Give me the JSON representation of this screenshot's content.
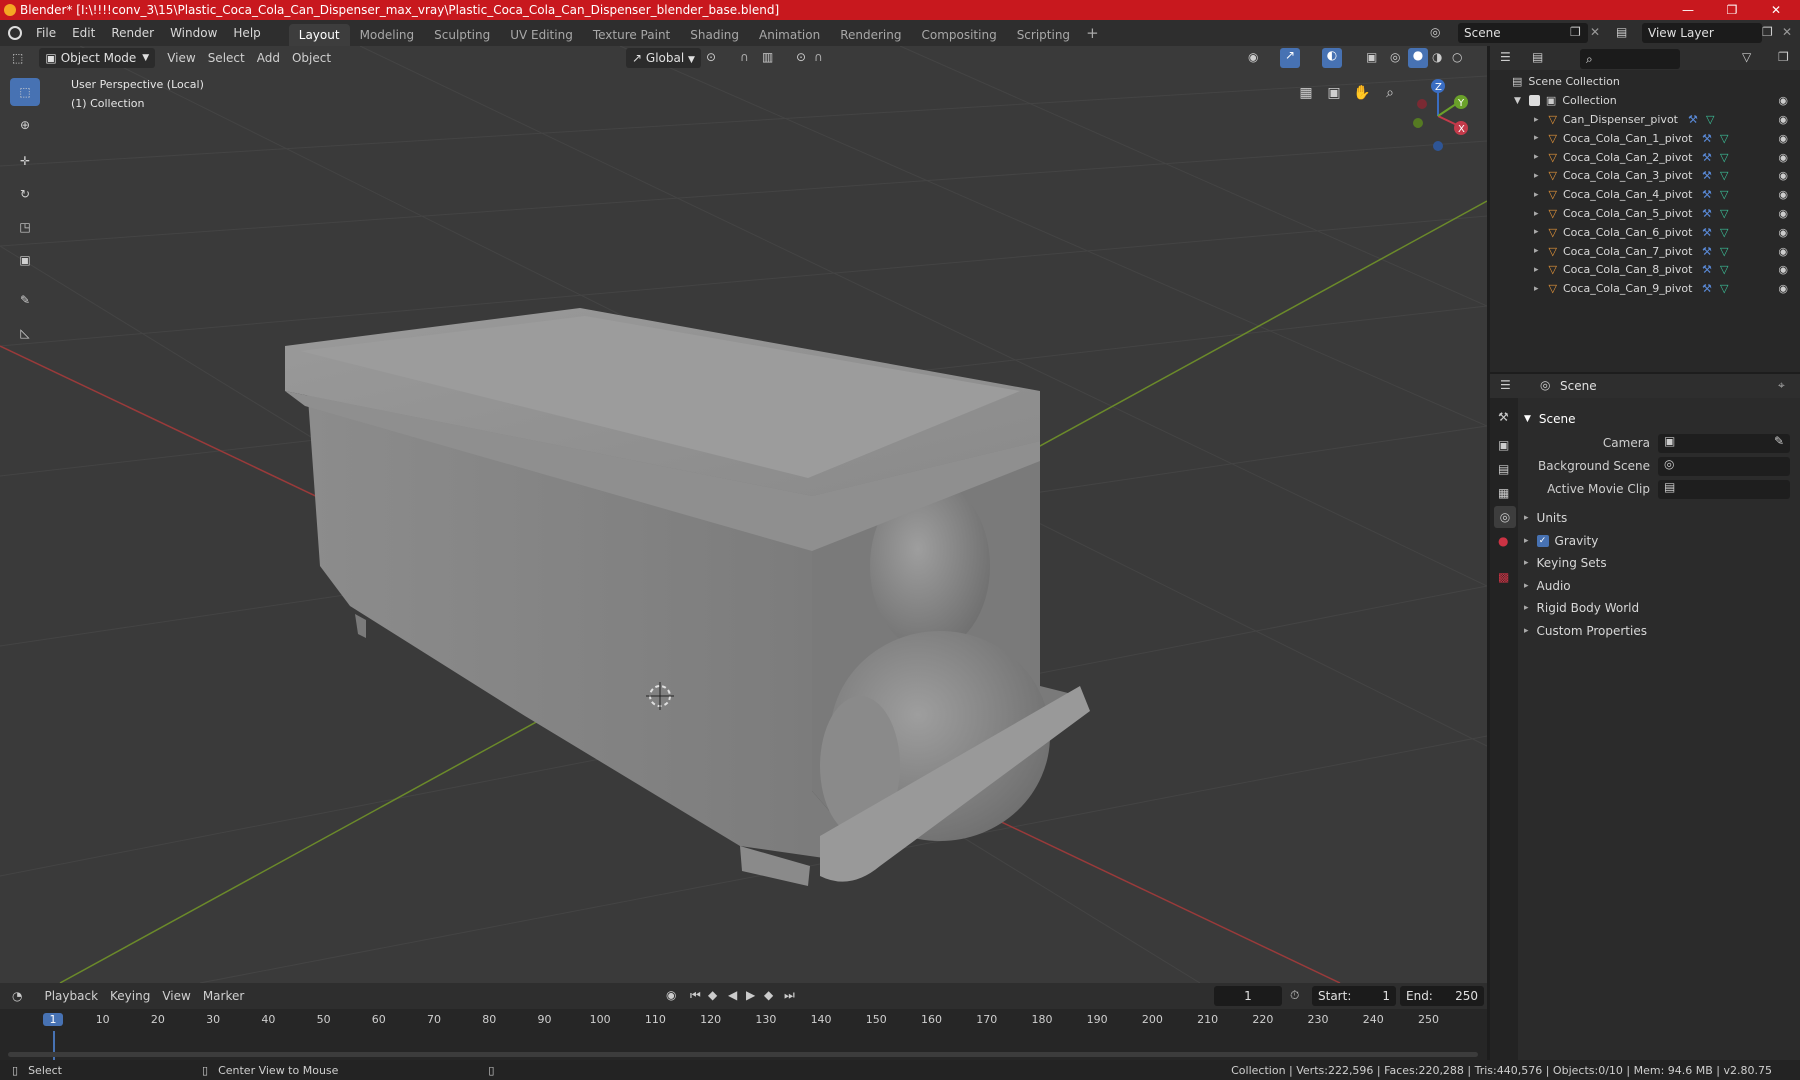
{
  "title": "Blender* [I:\\!!!!conv_3\\15\\Plastic_Coca_Cola_Can_Dispenser_max_vray\\Plastic_Coca_Cola_Can_Dispenser_blender_base.blend]",
  "menus": [
    "File",
    "Edit",
    "Render",
    "Window",
    "Help"
  ],
  "workspaces": [
    "Layout",
    "Modeling",
    "Sculpting",
    "UV Editing",
    "Texture Paint",
    "Shading",
    "Animation",
    "Rendering",
    "Compositing",
    "Scripting"
  ],
  "active_workspace": "Layout",
  "scene_name": "Scene",
  "view_layer": "View Layer",
  "viewport": {
    "mode": "Object Mode",
    "menus": [
      "View",
      "Select",
      "Add",
      "Object"
    ],
    "transform": "Global",
    "perspective": "User Perspective (Local)",
    "collection": "(1) Collection",
    "gizmo": {
      "x": "X",
      "y": "Y",
      "z": "Z"
    }
  },
  "outliner": {
    "root": "Scene Collection",
    "collection": "Collection",
    "objects": [
      "Can_Dispenser_pivot",
      "Coca_Cola_Can_1_pivot",
      "Coca_Cola_Can_2_pivot",
      "Coca_Cola_Can_3_pivot",
      "Coca_Cola_Can_4_pivot",
      "Coca_Cola_Can_5_pivot",
      "Coca_Cola_Can_6_pivot",
      "Coca_Cola_Can_7_pivot",
      "Coca_Cola_Can_8_pivot",
      "Coca_Cola_Can_9_pivot"
    ]
  },
  "properties": {
    "header": "Scene",
    "panel": "Scene",
    "camera_label": "Camera",
    "bg_scene_label": "Background Scene",
    "movie_clip_label": "Active Movie Clip",
    "sections": [
      "Units",
      "Gravity",
      "Keying Sets",
      "Audio",
      "Rigid Body World",
      "Custom Properties"
    ],
    "gravity_checked": true
  },
  "timeline": {
    "menus": [
      "Playback",
      "Keying",
      "View",
      "Marker"
    ],
    "current_frame": "1",
    "start_label": "Start:",
    "start": "1",
    "end_label": "End:",
    "end": "250",
    "ticks": [
      "1",
      "10",
      "20",
      "30",
      "40",
      "50",
      "60",
      "70",
      "80",
      "90",
      "100",
      "110",
      "120",
      "130",
      "140",
      "150",
      "160",
      "170",
      "180",
      "190",
      "200",
      "210",
      "220",
      "230",
      "240",
      "250"
    ]
  },
  "status": {
    "select": "Select",
    "center": "Center View to Mouse",
    "stats": "Collection | Verts:222,596 | Faces:220,288 | Tris:440,576 | Objects:0/10 | Mem: 94.6 MB | v2.80.75"
  }
}
